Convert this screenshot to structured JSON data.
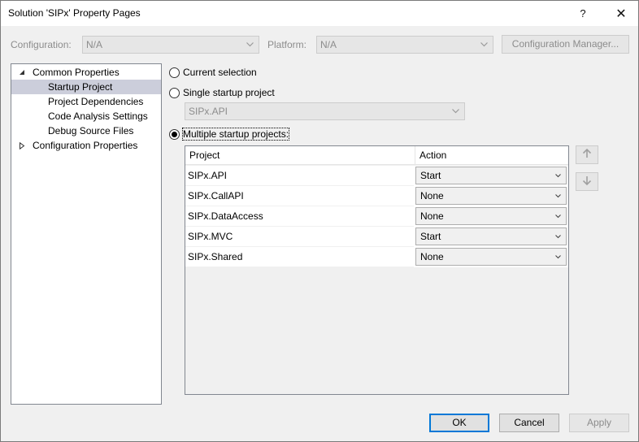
{
  "window": {
    "title": "Solution 'SIPx' Property Pages",
    "help_label": "?",
    "close_label": "✕"
  },
  "toolbar": {
    "configuration_label": "Configuration:",
    "configuration_value": "N/A",
    "platform_label": "Platform:",
    "platform_value": "N/A",
    "config_manager_label": "Configuration Manager..."
  },
  "tree": {
    "items": [
      {
        "label": "Common Properties",
        "expanded": true
      },
      {
        "label": "Startup Project",
        "selected": true
      },
      {
        "label": "Project Dependencies"
      },
      {
        "label": "Code Analysis Settings"
      },
      {
        "label": "Debug Source Files"
      },
      {
        "label": "Configuration Properties",
        "expanded": false
      }
    ]
  },
  "startup": {
    "current_selection_label": "Current selection",
    "single_label": "Single startup project",
    "single_value": "SIPx.API",
    "multiple_label": "Multiple startup projects:",
    "selected_option": "multiple"
  },
  "grid": {
    "columns": [
      "Project",
      "Action"
    ],
    "rows": [
      {
        "project": "SIPx.API",
        "action": "Start"
      },
      {
        "project": "SIPx.CallAPI",
        "action": "None"
      },
      {
        "project": "SIPx.DataAccess",
        "action": "None"
      },
      {
        "project": "SIPx.MVC",
        "action": "Start"
      },
      {
        "project": "SIPx.Shared",
        "action": "None"
      }
    ]
  },
  "buttons": {
    "ok": "OK",
    "cancel": "Cancel",
    "apply": "Apply"
  },
  "icons": {
    "move_up": "arrow-up-icon",
    "move_down": "arrow-down-icon",
    "dropdown": "chevron-down-icon"
  },
  "colors": {
    "selection": "#cccedb",
    "default_button_border": "#0078d7",
    "disabled_text": "#8c8c8c"
  }
}
